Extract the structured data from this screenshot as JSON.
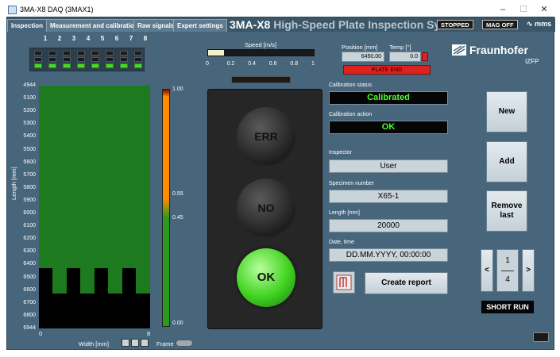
{
  "window": {
    "title": "3MA-X8 DAQ (3MAX1)",
    "minimize": "–",
    "maximize": "☐",
    "close": "✕"
  },
  "tabs": [
    {
      "label": "Inspection"
    },
    {
      "label": "Measurement and calibration"
    },
    {
      "label": "Raw signals"
    },
    {
      "label": "Expert settings"
    }
  ],
  "app_title": {
    "main": "3MA-X8",
    "sub": "High-Speed Plate Inspection System"
  },
  "status_badges": {
    "stopped": "STOPPED",
    "mag": "MAG OFF"
  },
  "mms_logo": "mms",
  "channels": {
    "numbers": [
      "1",
      "2",
      "3",
      "4",
      "5",
      "6",
      "7",
      "8"
    ],
    "led_green": [
      true,
      true,
      true,
      true,
      true,
      true,
      true,
      true
    ]
  },
  "length_map": {
    "ylabel": "Length [mm]",
    "xlabel": "Width [mm]",
    "x_ticks": [
      "0",
      "8"
    ],
    "y_ticks": [
      "4944",
      "5100",
      "5200",
      "5300",
      "5400",
      "5500",
      "5600",
      "5700",
      "5800",
      "5900",
      "6000",
      "6100",
      "6200",
      "6300",
      "6400",
      "6500",
      "6600",
      "6700",
      "6800",
      "6944"
    ],
    "colorbar_ticks": [
      "1.00",
      "0.55",
      "0.45",
      "0.00"
    ],
    "frame_label": "Frame"
  },
  "speed": {
    "label": "Speed [m/s]",
    "ticks": [
      "0",
      "0.2",
      "0.4",
      "0.6",
      "0.8",
      "1"
    ],
    "value": 0.15
  },
  "position": {
    "label": "Position [mm]",
    "value": "6450.00"
  },
  "temp": {
    "label": "Temp [°]",
    "value": "0.0"
  },
  "plate_end": "PLATE END",
  "traffic_light": {
    "top": "ERR",
    "middle": "NO",
    "bottom": "OK"
  },
  "calibration": {
    "status_label": "Calibration status",
    "status_value": "Calibrated",
    "action_label": "Calibration action",
    "action_value": "OK"
  },
  "inspector": {
    "label": "Inspector",
    "value": "User"
  },
  "specimen": {
    "label": "Specimen number",
    "value": "X65-1"
  },
  "length": {
    "label": "Length [mm]",
    "value": "20000"
  },
  "datetime": {
    "label": "Date, time",
    "value": "DD.MM.YYYY, 00:00:00"
  },
  "create_report": "Create report",
  "buttons": {
    "new": "New",
    "add": "Add",
    "remove_last": "Remove last"
  },
  "pager": {
    "prev": "<",
    "next": ">",
    "current": "1",
    "total": "4"
  },
  "short_run": "SHORT RUN",
  "logo": {
    "name": "Fraunhofer",
    "sub": "IZFP"
  }
}
